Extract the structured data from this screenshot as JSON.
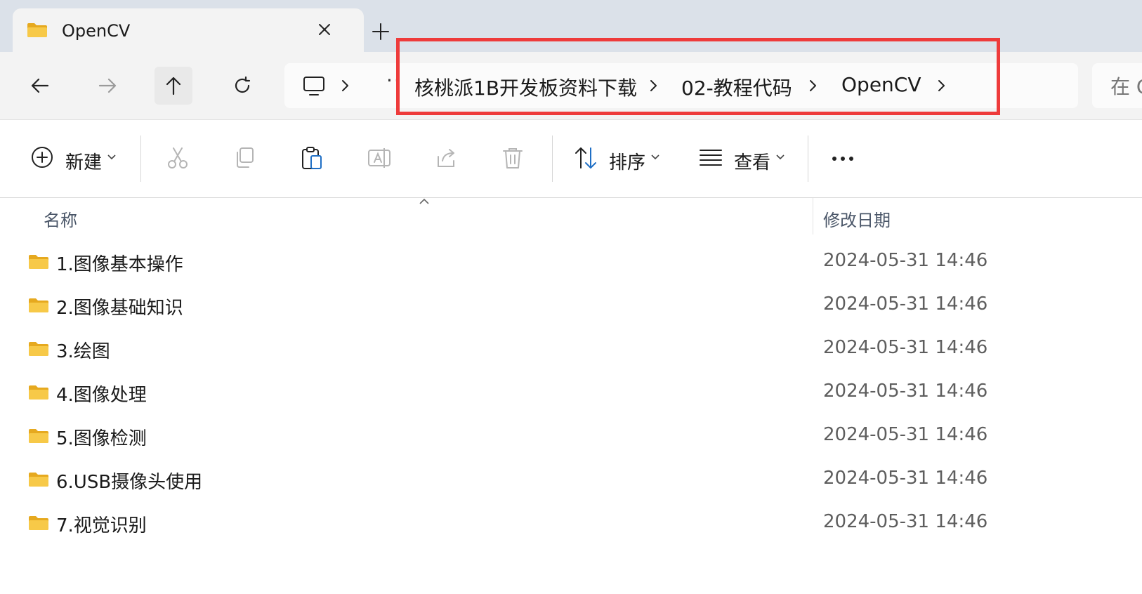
{
  "tab": {
    "title": "OpenCV"
  },
  "address": {
    "more": "··",
    "crumbs": [
      "核桃派1B开发板资料下载",
      "02-教程代码",
      "OpenCV"
    ]
  },
  "search": {
    "placeholder": "在 C"
  },
  "commandbar": {
    "new_label": "新建",
    "sort_label": "排序",
    "view_label": "查看"
  },
  "columns": {
    "name": "名称",
    "date": "修改日期"
  },
  "files": [
    {
      "name": "1.图像基本操作",
      "date": "2024-05-31 14:46"
    },
    {
      "name": "2.图像基础知识",
      "date": "2024-05-31 14:46"
    },
    {
      "name": "3.绘图",
      "date": "2024-05-31 14:46"
    },
    {
      "name": "4.图像处理",
      "date": "2024-05-31 14:46"
    },
    {
      "name": "5.图像检测",
      "date": "2024-05-31 14:46"
    },
    {
      "name": "6.USB摄像头使用",
      "date": "2024-05-31 14:46"
    },
    {
      "name": "7.视觉识别",
      "date": "2024-05-31 14:46"
    }
  ],
  "colors": {
    "highlight": "#ee3b3b",
    "folder": "#f7c948",
    "folder_dark": "#e6a91f"
  }
}
